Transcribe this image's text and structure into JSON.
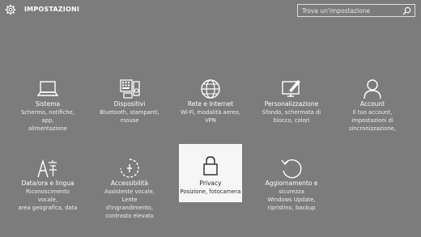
{
  "header": {
    "title": "IMPOSTAZIONI",
    "search_placeholder": "Trova un'impostazione"
  },
  "tiles": [
    {
      "title": "Sistema",
      "desc": [
        "Schermo, notifiche, app,",
        "alimentazione"
      ],
      "icon": "laptop-icon"
    },
    {
      "title": "Dispositivi",
      "desc": [
        "Bluetooth, stampanti,",
        "mouse"
      ],
      "icon": "devices-icon"
    },
    {
      "title": "Rete e Internet",
      "desc": [
        "Wi-Fi, modalità aereo,",
        "VPN"
      ],
      "icon": "globe-icon"
    },
    {
      "title": "Personalizzazione",
      "desc": [
        "Sfondo, schermata di",
        "blocco, colori"
      ],
      "icon": "personalization-icon"
    },
    {
      "title": "Account",
      "desc": [
        "Il tuo account,",
        "impostazioni di",
        "sincronizzazione,"
      ],
      "icon": "person-icon"
    },
    {
      "title": "Data/ora e lingua",
      "desc": [
        "Riconoscimento vocale,",
        "area geografica, data"
      ],
      "icon": "language-icon"
    },
    {
      "title": "Accessibilità",
      "desc": [
        "Assistente vocale, Lente",
        "d'ingrandimento,",
        "contrasto elevato"
      ],
      "icon": "accessibility-icon"
    },
    {
      "title": "Privacy",
      "desc": [
        "Posizione, fotocamera"
      ],
      "icon": "lock-icon",
      "selected": true
    },
    {
      "title": "Aggiornamento e",
      "desc": [
        "sicurezza",
        "Windows Update,",
        "ripristino, backup"
      ],
      "icon": "update-icon"
    }
  ]
}
